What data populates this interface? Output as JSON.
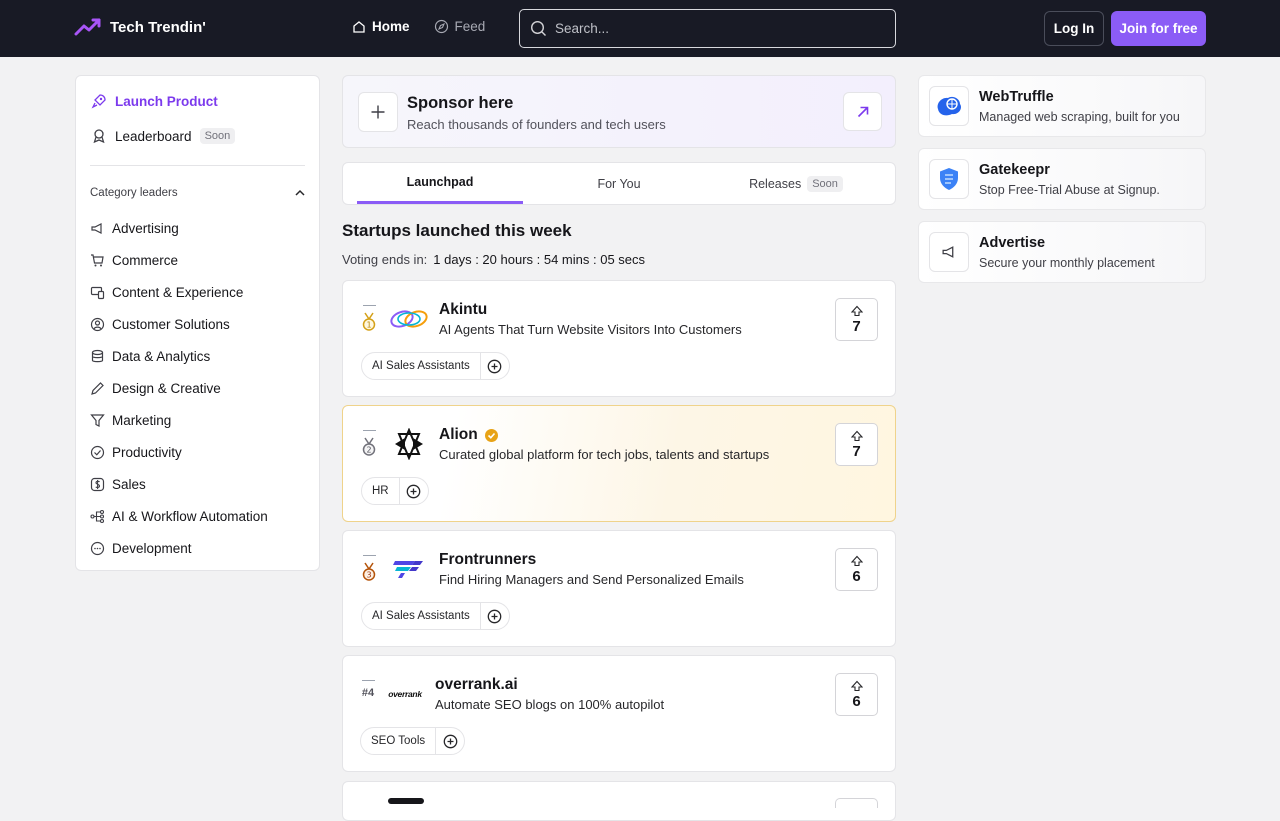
{
  "header": {
    "brand": "Tech Trendin'",
    "nav": [
      {
        "label": "Home"
      },
      {
        "label": "Feed"
      }
    ],
    "search_placeholder": "Search...",
    "login_label": "Log In",
    "join_label": "Join for free"
  },
  "sidebar": {
    "launch_label": "Launch Product",
    "leaderboard_label": "Leaderboard",
    "leaderboard_badge": "Soon",
    "category_heading": "Category leaders",
    "categories": [
      {
        "label": "Advertising",
        "icon": "megaphone-icon"
      },
      {
        "label": "Commerce",
        "icon": "cart-icon"
      },
      {
        "label": "Content & Experience",
        "icon": "devices-icon"
      },
      {
        "label": "Customer Solutions",
        "icon": "user-circle-icon"
      },
      {
        "label": "Data & Analytics",
        "icon": "database-icon"
      },
      {
        "label": "Design & Creative",
        "icon": "pen-icon"
      },
      {
        "label": "Marketing",
        "icon": "funnel-icon"
      },
      {
        "label": "Productivity",
        "icon": "check-circle-icon"
      },
      {
        "label": "Sales",
        "icon": "dollar-icon"
      },
      {
        "label": "AI & Workflow Automation",
        "icon": "workflow-icon"
      },
      {
        "label": "Development",
        "icon": "code-icon"
      }
    ]
  },
  "sponsor": {
    "title": "Sponsor here",
    "subtitle": "Reach thousands of founders and tech users"
  },
  "tabs": [
    {
      "label": "Launchpad",
      "badge": ""
    },
    {
      "label": "For You",
      "badge": ""
    },
    {
      "label": "Releases",
      "badge": "Soon"
    }
  ],
  "main": {
    "section_title": "Startups launched this week",
    "voting_label": "Voting ends in:",
    "countdown": "1 days : 20 hours : 54 mins : 05 secs",
    "products": [
      {
        "rank": "1",
        "name": "Akintu",
        "desc": "AI Agents That Turn Website Visitors Into Customers",
        "tag": "AI Sales Assistants",
        "votes": "7"
      },
      {
        "rank": "2",
        "name": "Alion",
        "desc": "Curated global platform for tech jobs, talents and startups",
        "tag": "HR",
        "votes": "7"
      },
      {
        "rank": "3",
        "name": "Frontrunners",
        "desc": "Find Hiring Managers and Send Personalized Emails",
        "tag": "AI Sales Assistants",
        "votes": "6"
      },
      {
        "rank": "#4",
        "name": "overrank.ai",
        "desc": "Automate SEO blogs on 100% autopilot",
        "tag": "SEO Tools",
        "votes": "6",
        "logo_text": "overrank"
      }
    ]
  },
  "right": [
    {
      "title": "WebTruffle",
      "subtitle": "Managed web scraping, built for you"
    },
    {
      "title": "Gatekeepr",
      "subtitle": "Stop Free-Trial Abuse at Signup."
    },
    {
      "title": "Advertise",
      "subtitle": "Secure your monthly placement"
    }
  ],
  "colors": {
    "accent": "#8b5cf6",
    "header_bg": "#181a25",
    "highlight_border": "#efd38b"
  }
}
